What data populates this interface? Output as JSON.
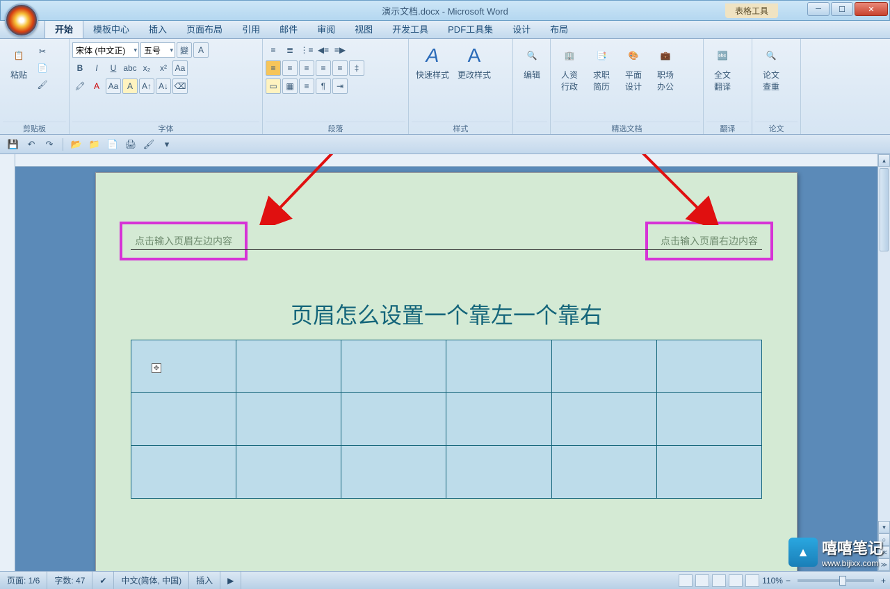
{
  "title": "演示文档.docx - Microsoft Word",
  "context_tools": "表格工具",
  "tabs": [
    "开始",
    "模板中心",
    "插入",
    "页面布局",
    "引用",
    "邮件",
    "审阅",
    "视图",
    "开发工具",
    "PDF工具集",
    "设计",
    "布局"
  ],
  "active_tab": 0,
  "groups": {
    "clipboard": {
      "paste": "粘贴",
      "label": "剪贴板"
    },
    "font": {
      "name": "宋体 (中文正)",
      "size": "五号",
      "label": "字体"
    },
    "paragraph": {
      "label": "段落"
    },
    "styles": {
      "quick": "快速样式",
      "change": "更改样式",
      "label": "样式"
    },
    "editing": {
      "edit": "编辑"
    },
    "featured": {
      "a": "人资\n行政",
      "b": "求职\n简历",
      "c": "平面\n设计",
      "d": "职场\n办公",
      "label": "精选文档"
    },
    "translate": {
      "btn": "全文\n翻译",
      "label": "翻译"
    },
    "thesis": {
      "btn": "论文\n查重",
      "label": "论文"
    }
  },
  "document": {
    "header_left": "点击输入页眉左边内容",
    "header_right": "点击输入页眉右边内容",
    "title": "页眉怎么设置一个靠左一个靠右"
  },
  "status": {
    "page": "页面: 1/6",
    "words": "字数: 47",
    "lang": "中文(简体, 中国)",
    "mode": "插入",
    "zoom": "110%"
  },
  "watermark": {
    "name": "嘻嘻笔记",
    "url": "www.bijixx.com"
  }
}
